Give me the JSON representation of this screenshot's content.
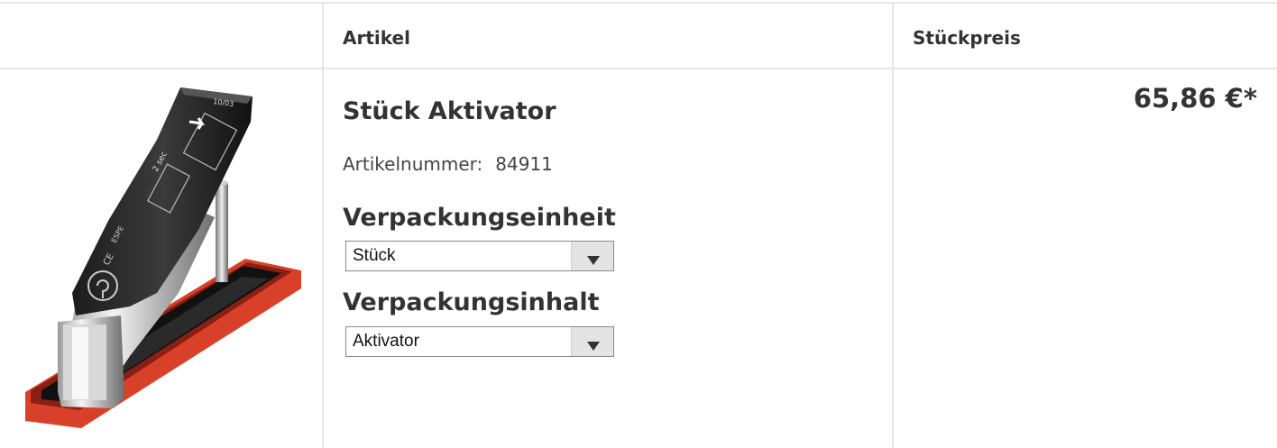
{
  "table": {
    "headers": {
      "image": "",
      "article": "Artikel",
      "unit_price": "Stückpreis"
    }
  },
  "product": {
    "name": "Stück Aktivator",
    "article_number_label": "Artikelnummer:",
    "article_number": "84911",
    "packaging_unit_heading": "Verpackungseinheit",
    "packaging_unit_value": "Stück",
    "packaging_content_heading": "Verpackungsinhalt",
    "packaging_content_value": "Aktivator",
    "price": "65,86 €*",
    "image_icon": "dental-activator-device-image"
  },
  "colors": {
    "text": "#333333",
    "border": "#e6e6e6",
    "select_arrow_bg": "#e4e4e4",
    "tray_red": "#d9402a"
  }
}
